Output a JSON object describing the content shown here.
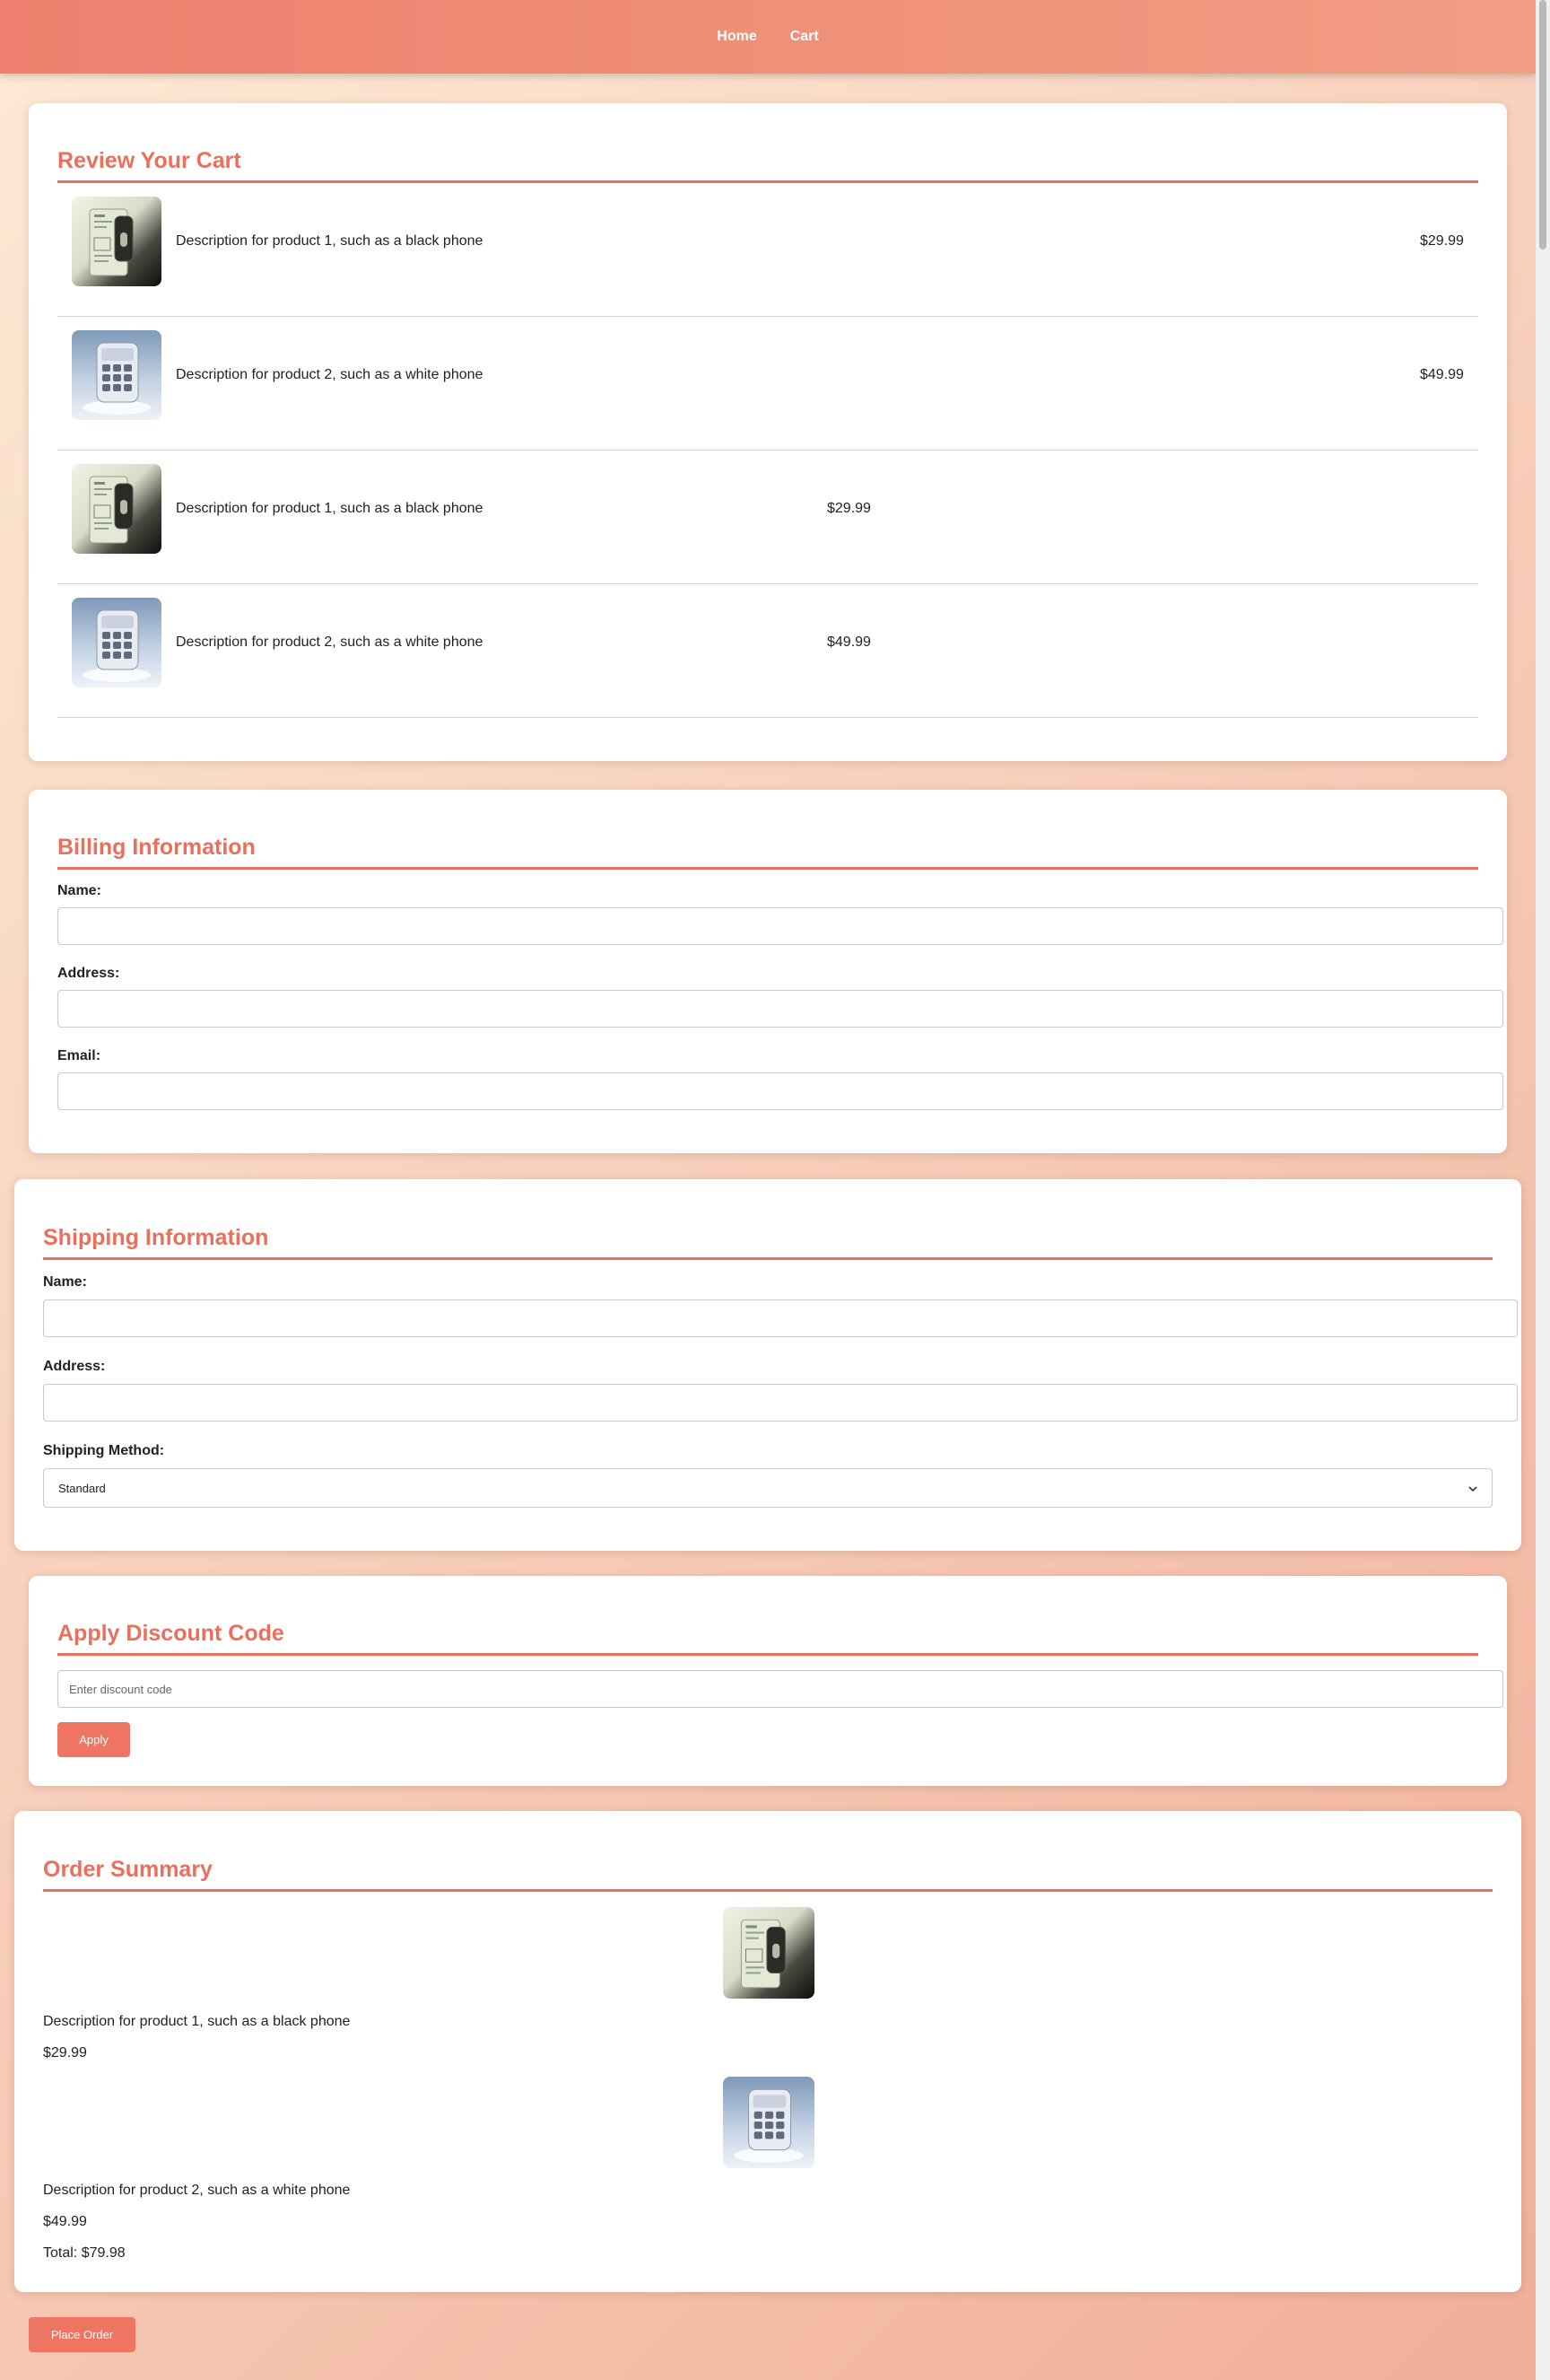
{
  "nav": {
    "home": "Home",
    "cart": "Cart"
  },
  "cart": {
    "title": "Review Your Cart",
    "items": [
      {
        "description": "Description for product 1, such as a black phone",
        "price": "$29.99",
        "image": "black-phone-image"
      },
      {
        "description": "Description for product 2, such as a white phone",
        "price": "$49.99",
        "image": "white-phone-image"
      },
      {
        "description": "Description for product 1, such as a black phone",
        "price": "$29.99",
        "image": "black-phone-image"
      },
      {
        "description": "Description for product 2, such as a white phone",
        "price": "$49.99",
        "image": "white-phone-image"
      }
    ]
  },
  "billing": {
    "title": "Billing Information",
    "name_label": "Name:",
    "address_label": "Address:",
    "email_label": "Email:",
    "name_value": "",
    "address_value": "",
    "email_value": ""
  },
  "shipping": {
    "title": "Shipping Information",
    "name_label": "Name:",
    "address_label": "Address:",
    "method_label": "Shipping Method:",
    "method_value": "Standard"
  },
  "discount": {
    "title": "Apply Discount Code",
    "placeholder": "Enter discount code",
    "apply_label": "Apply"
  },
  "summary": {
    "title": "Order Summary",
    "items": [
      {
        "description": "Description for product 1, such as a black phone",
        "price": "$29.99"
      },
      {
        "description": "Description for product 2, such as a white phone",
        "price": "$49.99"
      }
    ],
    "total": "Total: $79.98"
  },
  "place_order_label": "Place Order",
  "colors": {
    "accent": "#ea6f5d",
    "button": "#ee7562",
    "nav": "#ee7f6e"
  }
}
